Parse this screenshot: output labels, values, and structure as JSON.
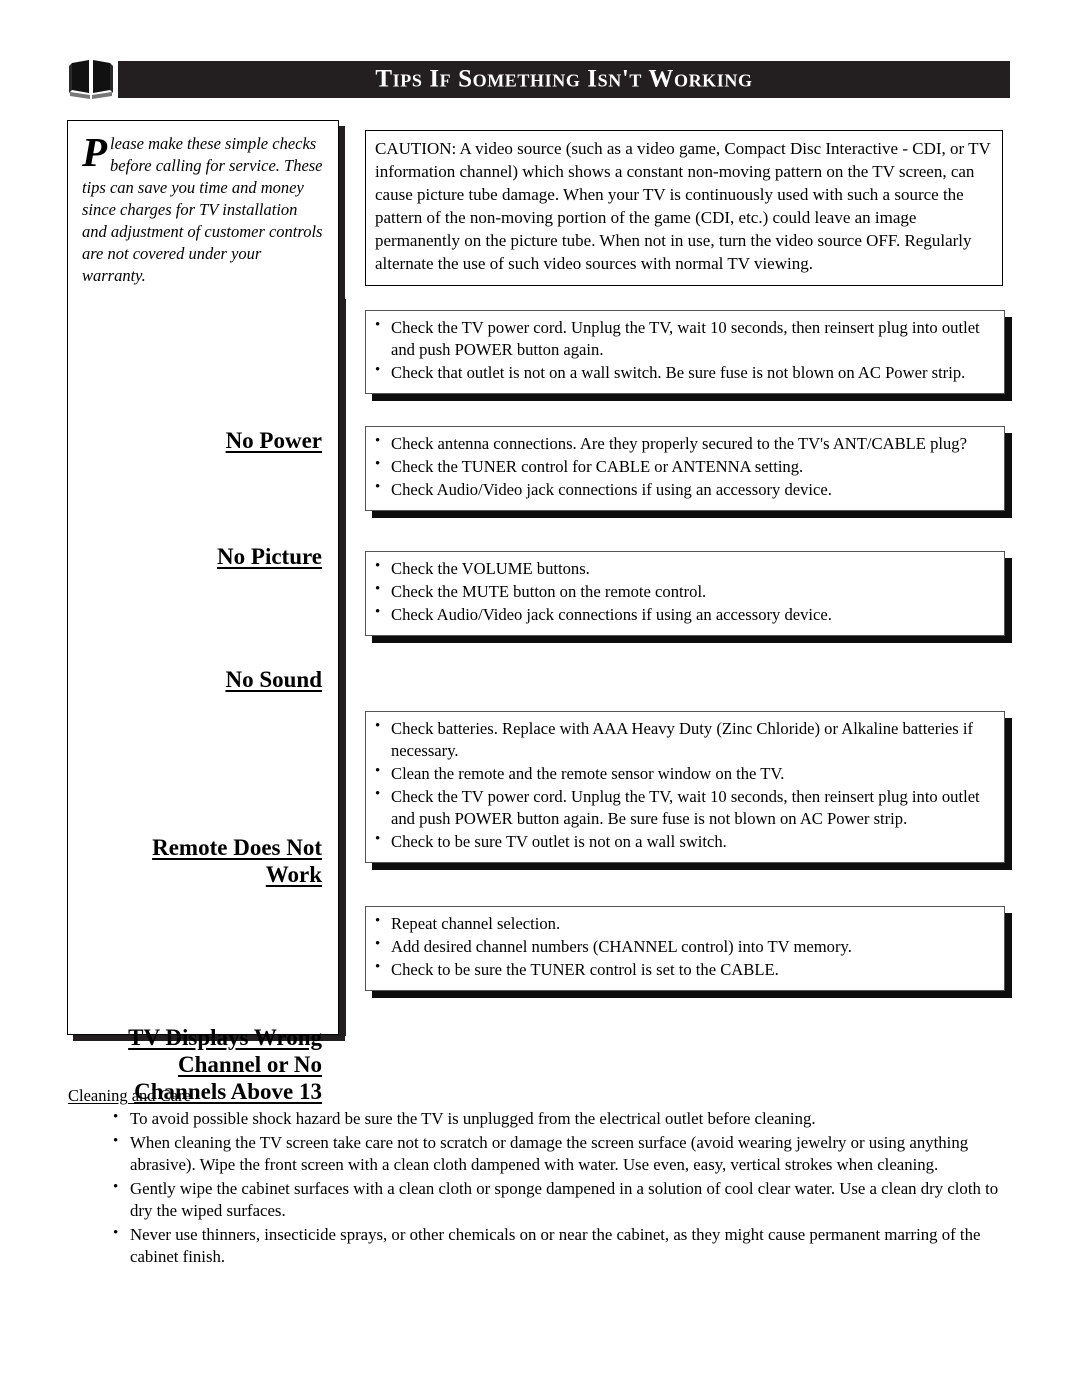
{
  "header": {
    "icon": "open-book-icon",
    "title": "Tips If Something Isn't Working",
    "bar_color": "#231f20"
  },
  "intro": {
    "dropcap": "P",
    "text": "lease make these simple checks before calling for service.  These tips can save you time and money since charges for TV installation and adjustment of customer controls are not covered under your warranty."
  },
  "caution": {
    "text": "CAUTION: A video source (such as a video game, Compact Disc Interactive - CDI, or TV information channel) which shows a constant non-moving pattern on the TV screen, can cause picture tube damage.  When your TV is continuously used with such a source the pattern of the non-moving portion of the game (CDI, etc.) could leave an image permanently on the picture tube.  When not in use, turn the video source OFF.  Regularly alternate the use of such video sources with normal TV viewing."
  },
  "sections": [
    {
      "heading": "No Power",
      "items": [
        "Check the TV power cord.  Unplug the TV, wait 10 seconds, then reinsert plug into outlet and push POWER button again.",
        "Check that outlet is not on a wall switch. Be sure fuse is not blown on AC Power strip."
      ]
    },
    {
      "heading": "No Picture",
      "items": [
        "Check antenna connections.  Are they properly secured to the TV's ANT/CABLE plug?",
        "Check the TUNER control for CABLE or ANTENNA setting.",
        "Check Audio/Video jack connections if using an accessory device."
      ]
    },
    {
      "heading": "No Sound",
      "items": [
        "Check the VOLUME buttons.",
        "Check the MUTE button on the remote control.",
        "Check Audio/Video jack connections if using an accessory device."
      ]
    },
    {
      "heading_line1": "Remote Does Not",
      "heading_line2": "Work",
      "items": [
        "Check batteries.  Replace with AAA Heavy Duty (Zinc Chloride) or Alkaline batteries if necessary.",
        "Clean the remote and the remote sensor window on the TV.",
        "Check the TV power cord.  Unplug the TV, wait 10 seconds, then reinsert plug into outlet and push POWER button again. Be sure fuse is not blown on AC Power strip.",
        "Check to be sure TV outlet is not on a wall switch."
      ]
    },
    {
      "heading_line1": "TV Displays Wrong",
      "heading_line2": "Channel or No",
      "heading_line3": "Channels Above 13",
      "items": [
        "Repeat channel selection.",
        "Add desired channel numbers (CHANNEL control) into TV memory.",
        "Check to be sure the TUNER control is set to the CABLE."
      ]
    }
  ],
  "care": {
    "title": "Cleaning and Care",
    "items": [
      "To avoid possible shock hazard be sure the TV is unplugged from the electrical outlet before cleaning.",
      "When cleaning the TV screen take care not to scratch or damage the screen surface (avoid wearing jewelry or using anything abrasive).  Wipe the front screen with a clean cloth dampened with water.  Use even, easy, vertical strokes when cleaning.",
      "Gently wipe the cabinet surfaces with a clean cloth or sponge dampened in a solution of cool clear water.  Use a clean dry cloth to dry the wiped surfaces.",
      "Never use thinners, insecticide sprays, or other chemicals on or near the cabinet, as they might cause permanent marring of the cabinet finish."
    ]
  }
}
